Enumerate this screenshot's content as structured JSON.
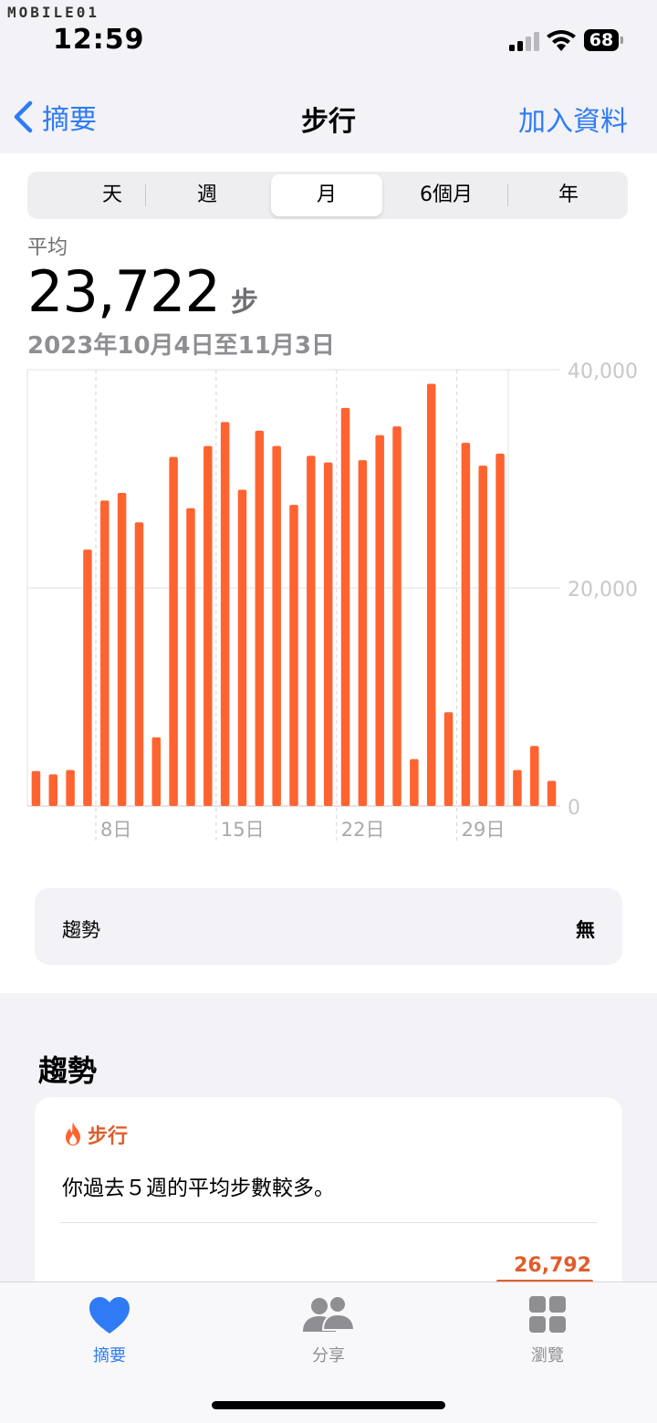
{
  "status_bar": {
    "watermark": "MOBILE01",
    "time": "12:59",
    "battery": "68"
  },
  "nav": {
    "back_label": "摘要",
    "title": "步行",
    "action_label": "加入資料"
  },
  "segments": [
    {
      "label": "天"
    },
    {
      "label": "週"
    },
    {
      "label": "月",
      "active": true
    },
    {
      "label": "6個月"
    },
    {
      "label": "年"
    }
  ],
  "summary": {
    "label": "平均",
    "value": "23,722",
    "unit": "步",
    "date_range": "2023年10月4日至11月3日"
  },
  "chart_data": {
    "type": "bar",
    "x": [
      "10-04",
      "10-05",
      "10-06",
      "10-07",
      "10-08",
      "10-09",
      "10-10",
      "10-11",
      "10-12",
      "10-13",
      "10-14",
      "10-15",
      "10-16",
      "10-17",
      "10-18",
      "10-19",
      "10-20",
      "10-21",
      "10-22",
      "10-23",
      "10-24",
      "10-25",
      "10-26",
      "10-27",
      "10-28",
      "10-29",
      "10-30",
      "10-31",
      "11-01",
      "11-02",
      "11-03"
    ],
    "values": [
      3200,
      2900,
      3300,
      23500,
      28000,
      28700,
      26000,
      6300,
      32000,
      27300,
      33000,
      35200,
      29000,
      34400,
      33000,
      27600,
      32100,
      31500,
      36500,
      31700,
      34000,
      34800,
      4300,
      38700,
      8600,
      33300,
      31200,
      32300,
      3300,
      5500,
      2300
    ],
    "x_tick_labels": [
      "8日",
      "15日",
      "22日",
      "29日"
    ],
    "x_tick_indices": [
      4,
      11,
      18,
      25
    ],
    "y_ticks": [
      "40,000",
      "20,000",
      "0"
    ],
    "ylim": [
      0,
      40000
    ],
    "bar_color": "#ff6330",
    "grid": true
  },
  "trend_row": {
    "label": "趨勢",
    "value": "無"
  },
  "trends_section": {
    "title": "趨勢",
    "card": {
      "icon": "flame-icon",
      "category": "步行",
      "text": "你過去５週的平均步數較多。",
      "number": "26,792"
    }
  },
  "tabbar": {
    "items": [
      {
        "label": "摘要",
        "icon": "heart-icon",
        "active": true,
        "color": "#2f7bf5"
      },
      {
        "label": "分享",
        "icon": "people-icon",
        "active": false,
        "color": "#8e8e93"
      },
      {
        "label": "瀏覽",
        "icon": "grid-icon",
        "active": false,
        "color": "#8e8e93"
      }
    ]
  }
}
